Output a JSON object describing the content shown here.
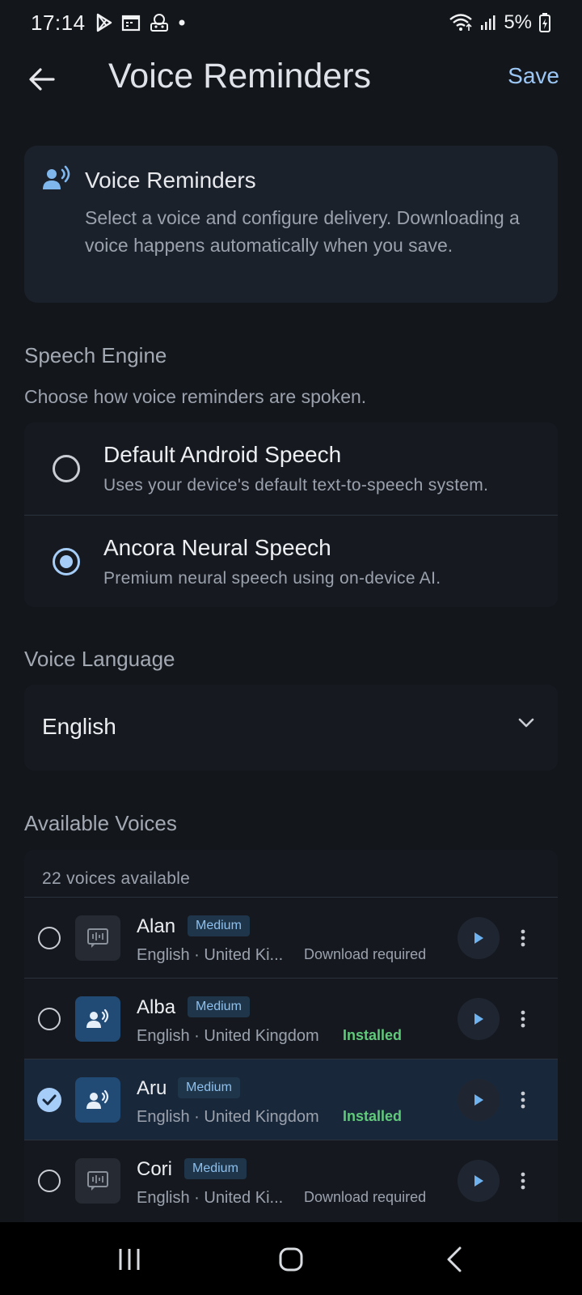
{
  "status_bar": {
    "time": "17:14",
    "battery_percent": "5%",
    "icons": [
      "play-store-icon",
      "calendar-icon",
      "robot-icon",
      "notification-dot-icon",
      "wifi-icon",
      "signal-icon",
      "battery-icon"
    ]
  },
  "app_bar": {
    "title": "Voice Reminders",
    "save_label": "Save"
  },
  "info_card": {
    "title": "Voice Reminders",
    "description": "Select a voice and configure delivery. Downloading a voice happens automatically when you save."
  },
  "speech_engine": {
    "heading": "Speech Engine",
    "subtitle": "Choose how voice reminders are spoken.",
    "options": [
      {
        "title": "Default Android Speech",
        "subtitle": "Uses your device's default text-to-speech system.",
        "selected": false
      },
      {
        "title": "Ancora Neural Speech",
        "subtitle": "Premium neural speech using on-device AI.",
        "selected": true
      }
    ]
  },
  "voice_language": {
    "heading": "Voice Language",
    "selected": "English"
  },
  "available_voices": {
    "heading": "Available Voices",
    "count_label": "22 voices available",
    "voices": [
      {
        "name": "Alan",
        "quality": "Medium",
        "meta": "English · United Ki...",
        "status": "Download required",
        "installed": false,
        "selected": false
      },
      {
        "name": "Alba",
        "quality": "Medium",
        "meta": "English · United Kingdom",
        "status": "Installed",
        "installed": true,
        "selected": false
      },
      {
        "name": "Aru",
        "quality": "Medium",
        "meta": "English · United Kingdom",
        "status": "Installed",
        "installed": true,
        "selected": true
      },
      {
        "name": "Cori",
        "quality": "Medium",
        "meta": "English · United Ki...",
        "status": "Download required",
        "installed": false,
        "selected": false
      }
    ]
  },
  "colors": {
    "background": "#13161b",
    "accent": "#9cc7f5",
    "installed": "#5fca7a"
  }
}
